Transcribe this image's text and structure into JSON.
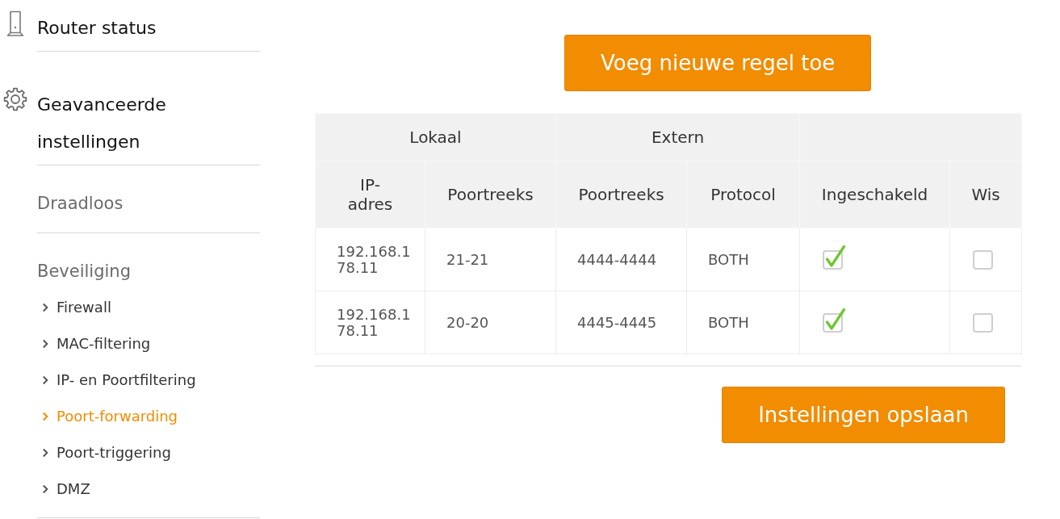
{
  "sidebar": {
    "sections": [
      {
        "kind": "device",
        "label": "Router status"
      },
      {
        "kind": "settings",
        "label": "Geavanceerde instellingen"
      },
      {
        "kind": "group",
        "label": "Draadloos"
      },
      {
        "kind": "group",
        "label": "Beveiliging",
        "children": [
          {
            "label": "Firewall",
            "selected": false
          },
          {
            "label": "MAC-filtering",
            "selected": false
          },
          {
            "label": "IP- en Poortfiltering",
            "selected": false
          },
          {
            "label": "Poort-forwarding",
            "selected": true
          },
          {
            "label": "Poort-triggering",
            "selected": false
          },
          {
            "label": "DMZ",
            "selected": false
          }
        ]
      }
    ]
  },
  "add_rule_button": {
    "label": "Voeg nieuwe regel toe"
  },
  "table": {
    "column_groups": [
      "Lokaal",
      "Extern"
    ],
    "columns": [
      "IP-adres",
      "Poortreeks",
      "Poortreeks",
      "Protocol",
      "Ingeschakeld",
      "Wis"
    ],
    "rows": [
      {
        "ip_address": "192.168.178.11",
        "local_port_range": "21-21",
        "external_port_range": "4444-4444",
        "protocol": "BOTH",
        "enabled": true,
        "delete": false
      },
      {
        "ip_address": "192.168.178.11",
        "local_port_range": "20-20",
        "external_port_range": "4445-4445",
        "protocol": "BOTH",
        "enabled": true,
        "delete": false
      }
    ]
  },
  "save_button": {
    "label": "Instellingen opslaan"
  }
}
